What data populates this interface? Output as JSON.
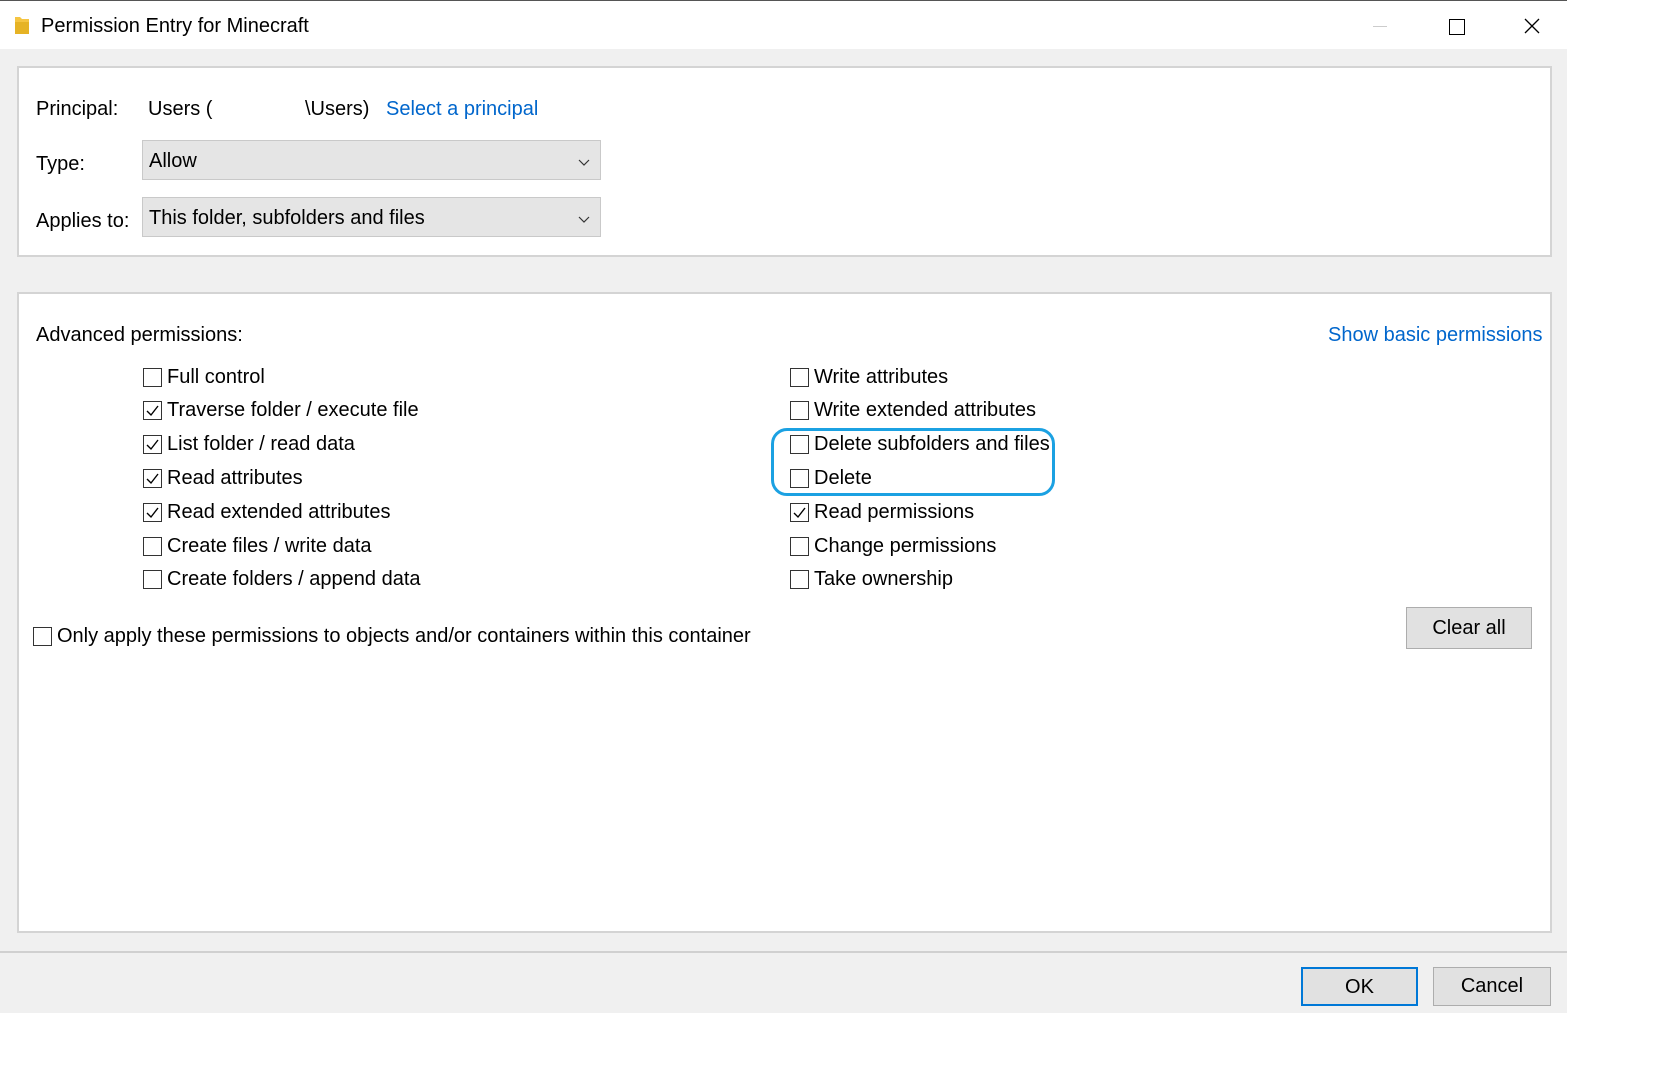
{
  "window": {
    "title": "Permission Entry for Minecraft",
    "icon": "folder-icon"
  },
  "principal": {
    "label": "Principal:",
    "value_prefix": "Users (",
    "value_suffix": "\\Users)",
    "link": "Select a principal"
  },
  "type": {
    "label": "Type:",
    "value": "Allow"
  },
  "applies_to": {
    "label": "Applies to:",
    "value": "This folder, subfolders and files"
  },
  "advanced": {
    "heading": "Advanced permissions:",
    "show_basic_link": "Show basic permissions",
    "left_column": [
      {
        "label": "Full control",
        "checked": false
      },
      {
        "label": "Traverse folder / execute file",
        "checked": true
      },
      {
        "label": "List folder / read data",
        "checked": true
      },
      {
        "label": "Read attributes",
        "checked": true
      },
      {
        "label": "Read extended attributes",
        "checked": true
      },
      {
        "label": "Create files / write data",
        "checked": false
      },
      {
        "label": "Create folders / append data",
        "checked": false
      }
    ],
    "right_column": [
      {
        "label": "Write attributes",
        "checked": false
      },
      {
        "label": "Write extended attributes",
        "checked": false
      },
      {
        "label": "Delete subfolders and files",
        "checked": false
      },
      {
        "label": "Delete",
        "checked": false
      },
      {
        "label": "Read permissions",
        "checked": true
      },
      {
        "label": "Change permissions",
        "checked": false
      },
      {
        "label": "Take ownership",
        "checked": false
      }
    ],
    "only_apply": {
      "label": "Only apply these permissions to objects and/or containers within this container",
      "checked": false
    },
    "clear_all": "Clear all"
  },
  "footer": {
    "ok": "OK",
    "cancel": "Cancel"
  },
  "colors": {
    "link": "#0066cc",
    "highlight": "#1ba1e2",
    "default_button_border": "#0078d7"
  }
}
